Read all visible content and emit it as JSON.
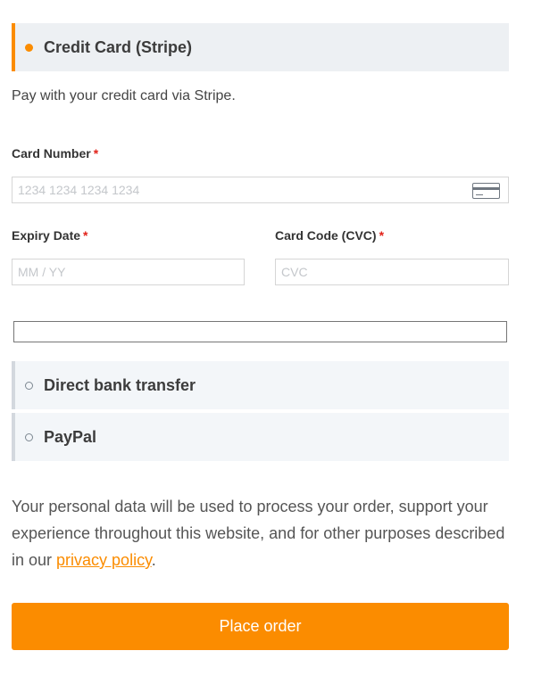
{
  "payment_methods": {
    "stripe": {
      "label": "Credit Card (Stripe)",
      "description": "Pay with your credit card via Stripe.",
      "card_number": {
        "label": "Card Number",
        "required_mark": "*",
        "placeholder": "1234 1234 1234 1234",
        "value": ""
      },
      "expiry": {
        "label": "Expiry Date",
        "required_mark": "*",
        "placeholder": "MM / YY",
        "value": ""
      },
      "cvc": {
        "label": "Card Code (CVC)",
        "required_mark": "*",
        "placeholder": "CVC",
        "value": ""
      },
      "card_icon": "credit-card-icon"
    },
    "bank": {
      "label": "Direct bank transfer"
    },
    "paypal": {
      "label": "PayPal"
    }
  },
  "privacy": {
    "text_before": "Your personal data will be used to process your order, support your experience throughout this website, and for other purposes described in our ",
    "link_text": "privacy policy",
    "text_after": "."
  },
  "place_order": {
    "label": "Place order"
  },
  "colors": {
    "accent": "#fb8c00",
    "required": "#e2231a",
    "panel_bg": "#edf0f3"
  }
}
